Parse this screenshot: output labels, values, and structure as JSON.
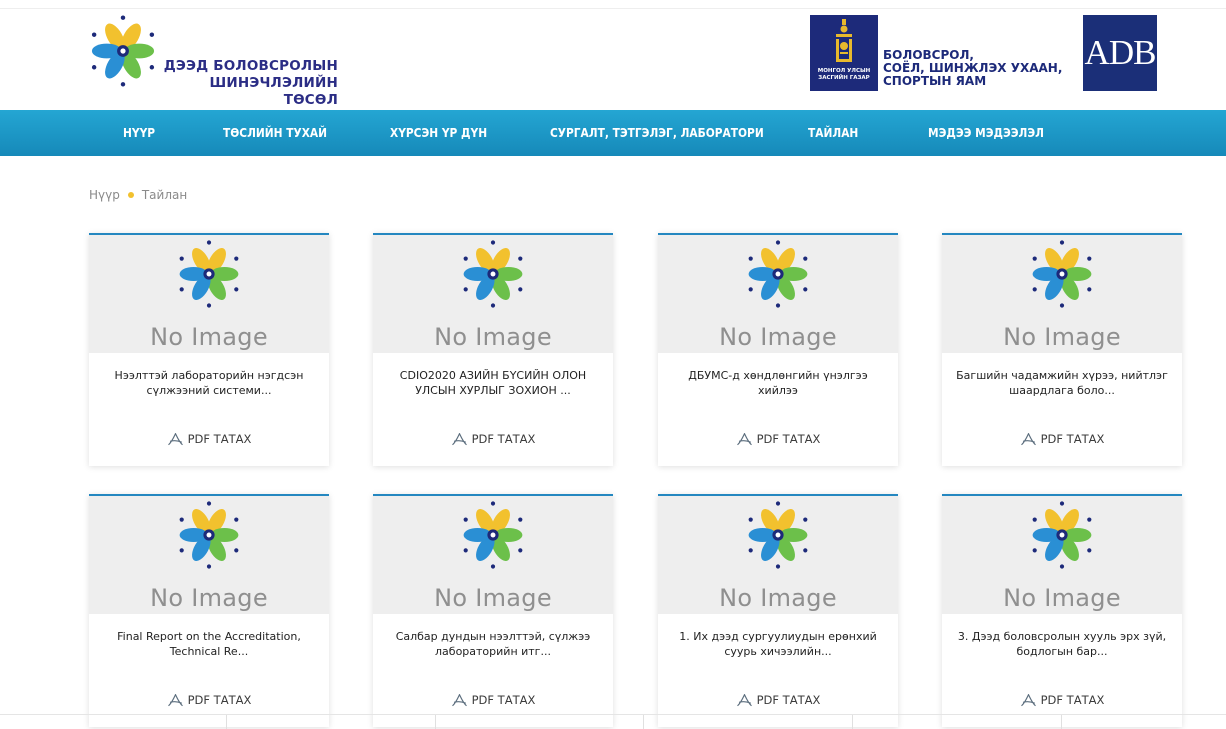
{
  "header": {
    "logo_line1": "ДЭЭД БОЛОВСРОЛЫН",
    "logo_line2": "ШИНЭЧЛЭЛИЙН ТӨСӨЛ",
    "gov_caption_line1": "МОНГОЛ УЛСЫН",
    "gov_caption_line2": "ЗАСГИЙН ГАЗАР",
    "ministry_line1": "БОЛОВСРОЛ,",
    "ministry_line2": "СОЁЛ, ШИНЖЛЭХ УХААН,",
    "ministry_line3": "СПОРТЫН ЯАМ",
    "adb_label": "ADB"
  },
  "nav": {
    "items": [
      {
        "label": "НҮҮР"
      },
      {
        "label": "ТӨСЛИЙН ТУХАЙ"
      },
      {
        "label": "ХҮРСЭН ҮР ДҮН"
      },
      {
        "label": "СУРГАЛТ, ТЭТГЭЛЭГ, ЛАБОРАТОРИ"
      },
      {
        "label": "ТАЙЛАН"
      },
      {
        "label": "МЭДЭЭ МЭДЭЭЛЭЛ"
      }
    ]
  },
  "breadcrumb": {
    "home": "Нүүр",
    "current": "Тайлан"
  },
  "cards": [
    {
      "no_image": "No Image",
      "title": "Нээлттэй лабораторийн нэгдсэн сүлжээний системи...",
      "download": "PDF ТАТАХ"
    },
    {
      "no_image": "No Image",
      "title": "CDIO2020 АЗИЙН БҮСИЙН ОЛОН УЛСЫН ХУРЛЫГ ЗОХИОН ...",
      "download": "PDF ТАТАХ"
    },
    {
      "no_image": "No Image",
      "title": "ДБУМС-д хөндлөнгийн үнэлгээ хийлээ",
      "download": "PDF ТАТАХ"
    },
    {
      "no_image": "No Image",
      "title": "Багшийн чадамжийн хүрээ, нийтлэг шаардлага боло...",
      "download": "PDF ТАТАХ"
    },
    {
      "no_image": "No Image",
      "title": "Final Report on the Accreditation, Technical Re...",
      "download": "PDF ТАТАХ"
    },
    {
      "no_image": "No Image",
      "title": "Салбар дундын нээлттэй, сүлжээ лабораторийн итг...",
      "download": "PDF ТАТАХ"
    },
    {
      "no_image": "No Image",
      "title": "1. Их дээд сургуулиудын ерөнхий суурь хичээлийн...",
      "download": "PDF ТАТАХ"
    },
    {
      "no_image": "No Image",
      "title": "3. Дээд боловсролын хууль эрх зүй, бодлогын бар...",
      "download": "PDF ТАТАХ"
    }
  ],
  "colors": {
    "nav_bg": "#1f9acb",
    "card_accent": "#2487c0",
    "petal_yellow": "#f2c12e",
    "petal_blue": "#2a8fd4",
    "petal_green": "#6cc04a",
    "brand_navy": "#1d2a7a"
  },
  "icons": {
    "logo": "flower-logo-icon",
    "pdf": "acrobat-pdf-icon",
    "breadcrumb_separator": "yellow-dot-icon"
  }
}
